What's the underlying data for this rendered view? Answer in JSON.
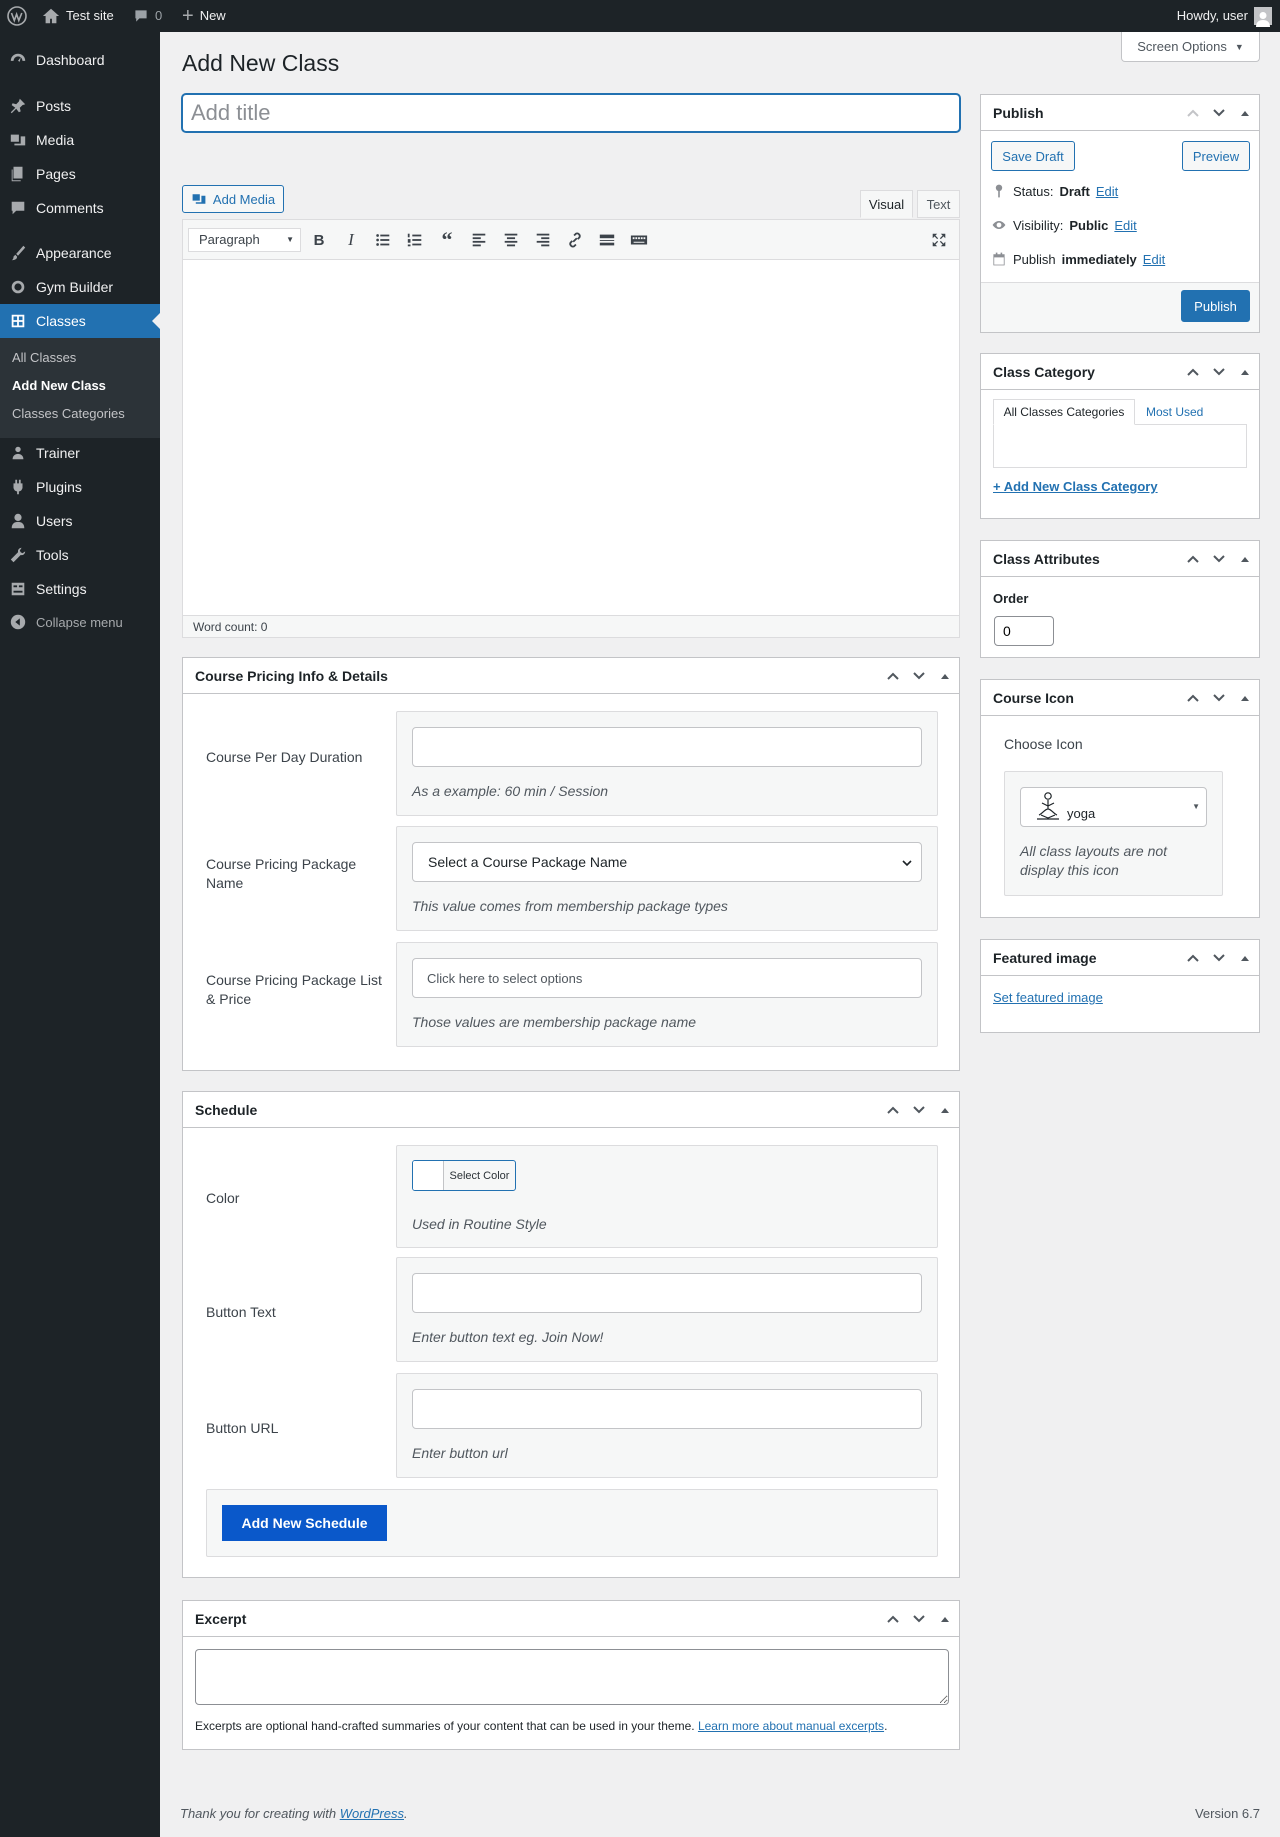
{
  "adminbar": {
    "site_name": "Test site",
    "comments_count": "0",
    "new_label": "New",
    "howdy": "Howdy, user"
  },
  "sidebar": {
    "items": [
      {
        "label": "Dashboard",
        "icon": "dashboard-icon"
      },
      {
        "label": "Posts",
        "icon": "pin-icon"
      },
      {
        "label": "Media",
        "icon": "media-icon"
      },
      {
        "label": "Pages",
        "icon": "pages-icon"
      },
      {
        "label": "Comments",
        "icon": "comment-icon"
      },
      {
        "label": "Appearance",
        "icon": "brush-icon"
      },
      {
        "label": "Gym Builder",
        "icon": "gym-icon"
      },
      {
        "label": "Classes",
        "icon": "classes-icon"
      },
      {
        "label": "Trainer",
        "icon": "trainer-icon"
      },
      {
        "label": "Plugins",
        "icon": "plugin-icon"
      },
      {
        "label": "Users",
        "icon": "user-icon"
      },
      {
        "label": "Tools",
        "icon": "wrench-icon"
      },
      {
        "label": "Settings",
        "icon": "settings-icon"
      },
      {
        "label": "Collapse menu",
        "icon": "collapse-icon"
      }
    ],
    "submenu": [
      "All Classes",
      "Add New Class",
      "Classes Categories"
    ]
  },
  "page": {
    "title": "Add New Class",
    "screen_options": "Screen Options",
    "title_placeholder": "Add title"
  },
  "editor": {
    "add_media": "Add Media",
    "tab_visual": "Visual",
    "tab_text": "Text",
    "format_select": "Paragraph",
    "word_count": "Word count: 0"
  },
  "pricing": {
    "title": "Course Pricing Info & Details",
    "per_day_label": "Course Per Day Duration",
    "per_day_desc": "As a example: 60 min / Session",
    "package_name_label": "Course Pricing Package Name",
    "package_name_select": "Select a Course Package Name",
    "package_name_desc": "This value comes from membership package types",
    "package_list_label": "Course Pricing Package List & Price",
    "package_list_placeholder": "Click here to select options",
    "package_list_desc": "Those values are membership package name"
  },
  "schedule": {
    "title": "Schedule",
    "color_label": "Color",
    "color_button": "Select Color",
    "color_desc": "Used in Routine Style",
    "button_text_label": "Button Text",
    "button_text_desc": "Enter button text eg. Join Now!",
    "button_url_label": "Button URL",
    "button_url_desc": "Enter button url",
    "add_schedule": "Add New Schedule"
  },
  "excerpt": {
    "title": "Excerpt",
    "help": "Excerpts are optional hand-crafted summaries of your content that can be used in your theme.",
    "help_link": "Learn more about manual excerpts"
  },
  "publish": {
    "title": "Publish",
    "save_draft": "Save Draft",
    "preview": "Preview",
    "status_label": "Status:",
    "status_value": "Draft",
    "visibility_label": "Visibility:",
    "visibility_value": "Public",
    "publish_label": "Publish",
    "publish_value": "immediately",
    "edit": "Edit",
    "publish_button": "Publish"
  },
  "category": {
    "title": "Class Category",
    "tab_all": "All Classes Categories",
    "tab_most": "Most Used",
    "add_new": "+ Add New Class Category"
  },
  "attributes": {
    "title": "Class Attributes",
    "order_label": "Order",
    "order_value": "0"
  },
  "course_icon": {
    "title": "Course Icon",
    "choose_label": "Choose Icon",
    "selected": "yoga",
    "desc": "All class layouts are not display this icon"
  },
  "featured": {
    "title": "Featured image",
    "set_link": "Set featured image"
  },
  "footer": {
    "thanks": "Thank you for creating with",
    "wp_link": "WordPress",
    "version": "Version 6.7"
  },
  "colors": {
    "admin_dark": "#1d2327",
    "accent": "#2271b1",
    "schedule_button": "#0a58ca"
  }
}
